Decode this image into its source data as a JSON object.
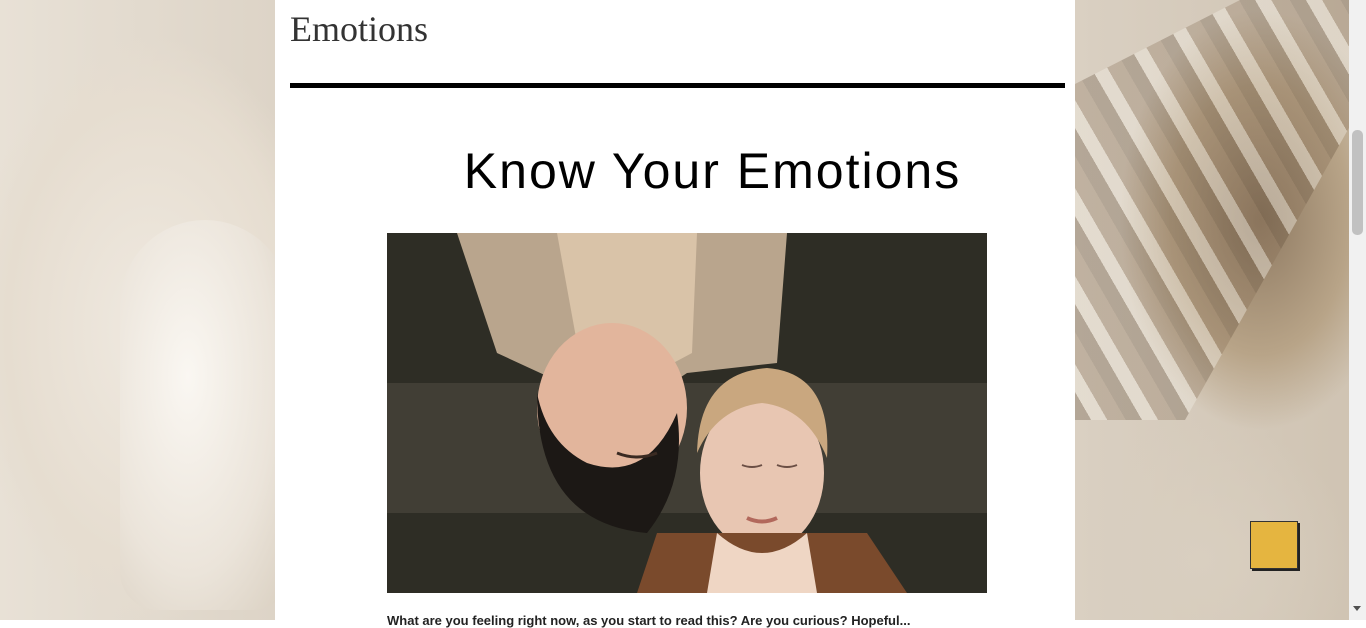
{
  "page": {
    "section_title": "Emotions",
    "headline": "Know Your Emotions",
    "hero_image": {
      "alt": "Two women lying on the ground with eyes closed",
      "icon": "photo"
    },
    "body_text_partial": "What are you feeling right now, as you start to read this? Are you curious? Hopeful..."
  },
  "floating_button": {
    "color": "#e5b540",
    "icon": "square-button"
  },
  "colors": {
    "content_bg": "#ffffff",
    "rule": "#000000",
    "accent": "#e5b540"
  }
}
